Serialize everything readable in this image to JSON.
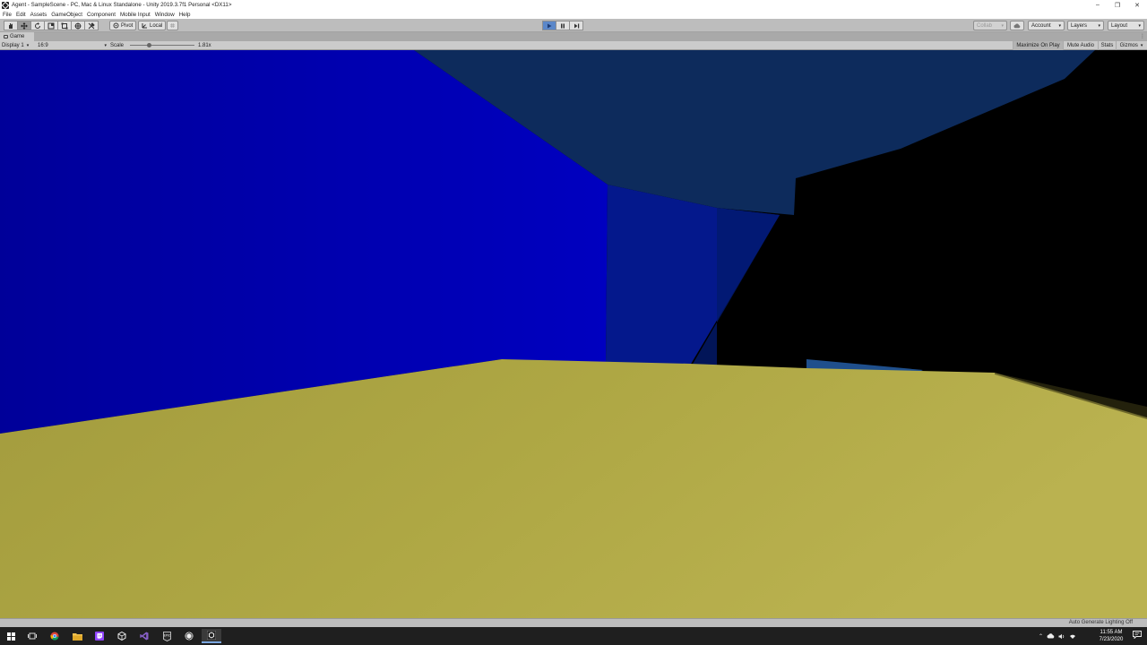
{
  "window": {
    "title": "Agent - SampleScene - PC, Mac & Linux Standalone - Unity 2019.3.7f1 Personal <DX11>",
    "controls": [
      "–",
      "❐",
      "✕"
    ]
  },
  "menu": [
    "File",
    "Edit",
    "Assets",
    "GameObject",
    "Component",
    "Mobile Input",
    "Window",
    "Help"
  ],
  "toolbar": {
    "tools": [
      "hand-icon",
      "move-icon",
      "rotate-icon",
      "scale-icon",
      "rect-icon",
      "transform-icon",
      "custom-tool-icon"
    ],
    "active_tool_index": 1,
    "pivot_label": "Pivot",
    "local_label": "Local",
    "collab_label": "Collab",
    "account_label": "Account",
    "layers_label": "Layers",
    "layout_label": "Layout",
    "play_state": "playing"
  },
  "game_view": {
    "tab_label": "Game",
    "display_label": "Display 1",
    "aspect_label": "16:9",
    "scale_label": "Scale",
    "scale_value": "1.81x",
    "scale_fraction": 0.27,
    "buttons": [
      "Maximize On Play",
      "Mute Audio",
      "Stats",
      "Gizmos"
    ],
    "active_button": "Maximize On Play"
  },
  "scene": {
    "left_wall_color": "#0000b4",
    "back_wall_color": "#02238a",
    "sky_color": "#0c2a5c",
    "floor_color": "#b0a845",
    "shadow_color": "#000000"
  },
  "status": {
    "message": "Auto Generate Lighting Off"
  },
  "taskbar": {
    "clock_time": "11:55 AM",
    "clock_date": "7/23/2020",
    "apps": [
      "windows-start-icon",
      "task-view-icon",
      "chrome-icon",
      "file-explorer-icon",
      "twitch-icon",
      "unity-hub-icon",
      "visual-studio-icon",
      "epic-games-icon",
      "unity-icon",
      "unity-editor-icon"
    ],
    "active_app_index": 9
  }
}
